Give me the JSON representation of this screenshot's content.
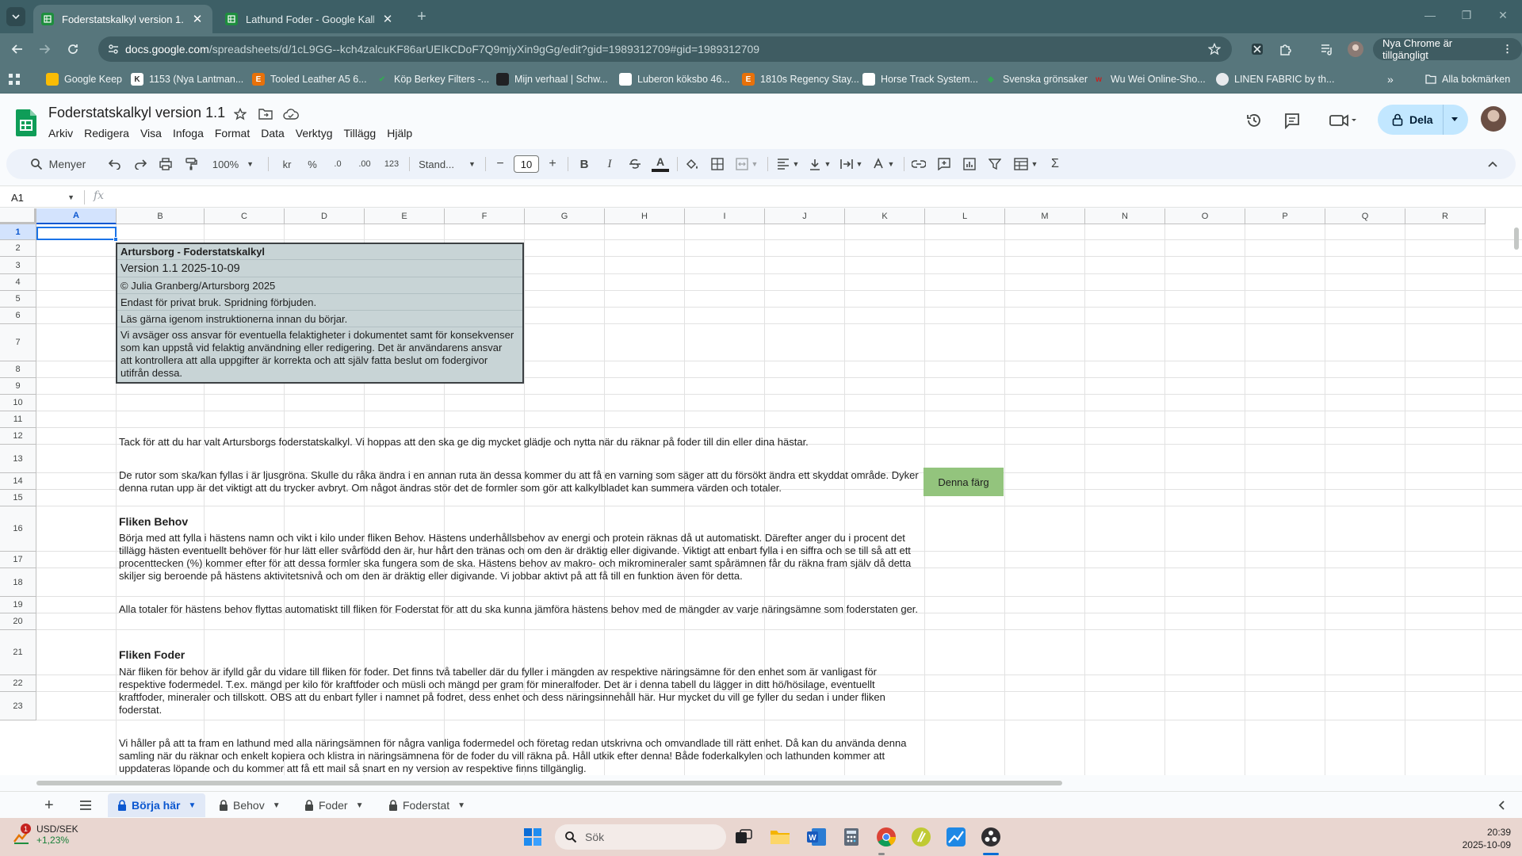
{
  "browser": {
    "tabs": [
      {
        "title": "Foderstatskalkyl version 1.1 - G",
        "active": true
      },
      {
        "title": "Lathund Foder - Google Kalkyl",
        "active": false
      }
    ],
    "url_host": "docs.google.com",
    "url_path": "/spreadsheets/d/1cL9GG--kch4zalcuKF86arUEIkCDoF7Q9mjyXin9gGg/edit?gid=1989312709#gid=1989312709",
    "update_label": "Nya Chrome är tillgängligt",
    "bookmarks": [
      {
        "label": "Google Keep",
        "color": "#fbbc04"
      },
      {
        "label": "1153 (Nya Lantman...",
        "color": "#ffffff"
      },
      {
        "label": "Tooled Leather A5 6...",
        "color": "#e8710a"
      },
      {
        "label": "Köp Berkey Filters -...",
        "color": "#34a853"
      },
      {
        "label": "Mijn verhaal | Schw...",
        "color": "#202124"
      },
      {
        "label": "Luberon köksbo 46...",
        "color": "#ffffff"
      },
      {
        "label": "1810s Regency Stay...",
        "color": "#e8710a"
      },
      {
        "label": "Horse Track System...",
        "color": "#ffffff"
      },
      {
        "label": "Svenska grönsaker",
        "color": "#34a853"
      },
      {
        "label": "Wu Wei Online-Sho...",
        "color": "#c5221f"
      },
      {
        "label": "LINEN FABRIC by th...",
        "color": "#e8eaed"
      }
    ],
    "all_bookmarks": "Alla bokmärken"
  },
  "sheets": {
    "doc_title": "Foderstatskalkyl version 1.1",
    "menu": [
      "Arkiv",
      "Redigera",
      "Visa",
      "Infoga",
      "Format",
      "Data",
      "Verktyg",
      "Tillägg",
      "Hjälp"
    ],
    "share_label": "Dela",
    "toolbar": {
      "search_menus": "Menyer",
      "zoom": "100%",
      "currency": "kr",
      "percent": "%",
      "dec_less": ".0",
      "dec_more": ".00",
      "number_format": "123",
      "font": "Stand...",
      "font_size": "10",
      "bold": "B",
      "italic": "I",
      "text_color": "A"
    },
    "name_box": "A1",
    "fx_label": "fx"
  },
  "grid": {
    "columns": [
      "A",
      "B",
      "C",
      "D",
      "E",
      "F",
      "G",
      "H",
      "I",
      "J",
      "K",
      "L",
      "M",
      "N",
      "O",
      "P",
      "Q",
      "R"
    ],
    "rows": [
      "1",
      "2",
      "3",
      "4",
      "5",
      "6",
      "7",
      "8",
      "9",
      "10",
      "11",
      "12",
      "13",
      "14",
      "15",
      "16",
      "17",
      "18",
      "19",
      "20",
      "21",
      "22",
      "23"
    ],
    "selected_cell": "A1",
    "infobox": {
      "title": "Artursborg - Foderstatskalkyl",
      "version": "Version 1.1 2025-10-09",
      "copyright": "© Julia Granberg/Artursborg 2025",
      "private": "Endast för privat bruk. Spridning förbjuden.",
      "read_first": "Läs gärna igenom instruktionerna innan du börjar.",
      "disclaimer": "Vi avsäger oss ansvar för eventuella felaktigheter i dokumentet samt för konsekvenser som kan uppstå vid felaktig användning eller redigering. Det är användarens ansvar att kontrollera att alla uppgifter är korrekta och att själv fatta beslut om fodergivor utifrån dessa."
    },
    "row11": "Tack för att du har valt Artursborgs foderstatskalkyl. Vi hoppas att den ska ge dig mycket glädje och nytta när du räknar på foder till din eller dina hästar.",
    "row13": "De rutor som ska/kan fyllas i är ljusgröna. Skulle du råka ändra i en annan ruta än dessa kommer du att få en varning som säger att du försökt ändra ett skyddat område. Dyker denna rutan upp är det viktigt att du trycker avbryt. Om något ändras stör det de formler som gör att kalkylbladet kan summera värden och totaler.",
    "green_cell": "Denna färg",
    "green_color": "#93c47d",
    "row15": "Fliken Behov",
    "row16": "Börja med att fylla i hästens namn och vikt i kilo under fliken Behov. Hästens underhållsbehov av energi och protein räknas då ut automatiskt. Därefter anger du i procent det tillägg hästen eventuellt behöver för hur lätt eller svårfödd den är, hur hårt den tränas och om den är dräktig eller digivande. Viktigt att enbart fylla i en siffra och se till så att ett procenttecken (%) kommer efter för att dessa formler ska fungera som de ska. Hästens behov av makro- och mikromineraler samt spårämnen får du räkna fram själv då detta skiljer sig beroende på hästens aktivitetsnivå och om den är dräktig eller digivande. Vi jobbar aktivt på att få till en funktion även för detta.",
    "row18": "Alla totaler för hästens behov flyttas automatiskt till fliken för Foderstat för att du ska kunna jämföra hästens behov med de mängder av varje näringsämne som foderstaten ger.",
    "row20": "Fliken Foder",
    "row21": "När fliken för behov är ifylld går du vidare till fliken för foder. Det finns två tabeller där du fyller i mängden av respektive näringsämne för den enhet som är vanligast för respektive fodermedel. T.ex. mängd per kilo för kraftfoder och müsli och mängd per gram för mineralfoder. Det är i denna tabell du lägger in ditt hö/hösilage, eventuellt kraftfoder, mineraler och tillskott. OBS att du enbart fyller i namnet på fodret, dess enhet och dess näringsinnehåll här. Hur mycket du vill ge fyller du sedan i under fliken foderstat.",
    "row23": "Vi håller på att ta fram en lathund med alla näringsämnen för några vanliga fodermedel och företag redan utskrivna och omvandlade till rätt enhet. Då kan du använda denna samling när du räknar och enkelt kopiera och klistra in näringsämnena för de foder du vill räkna på. Håll utkik efter denna! Både foderkalkylen och lathunden kommer att uppdateras löpande och du kommer att få ett mail så snart en ny version av respektive finns tillgänglig."
  },
  "sheet_tabs": [
    {
      "label": "Börja här",
      "active": true
    },
    {
      "label": "Behov",
      "active": false
    },
    {
      "label": "Foder",
      "active": false
    },
    {
      "label": "Foderstat",
      "active": false
    }
  ],
  "taskbar": {
    "ticker_pair": "USD/SEK",
    "ticker_change": "+1,23%",
    "ticker_badge": "1",
    "search_label": "Sök",
    "time": "20:39",
    "date": "2025-10-09"
  }
}
